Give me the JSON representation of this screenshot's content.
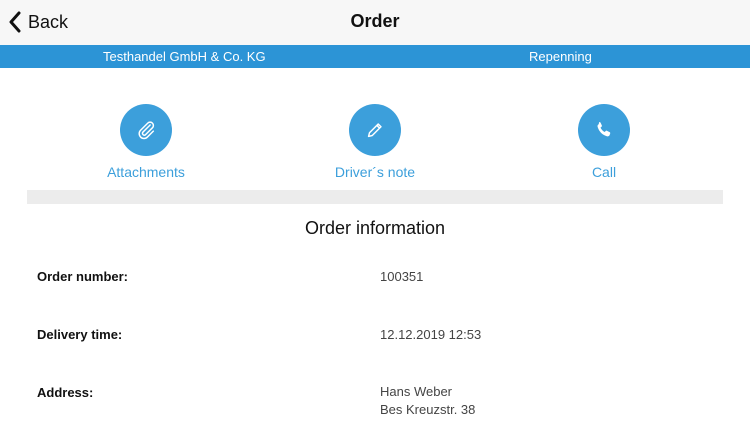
{
  "navbar": {
    "back_label": "Back",
    "title": "Order"
  },
  "infobar": {
    "company": "Testhandel GmbH & Co. KG",
    "person": "Repenning"
  },
  "actions": [
    {
      "label": "Attachments",
      "icon": "paperclip-icon"
    },
    {
      "label": "Driver´s note",
      "icon": "pencil-icon"
    },
    {
      "label": "Call",
      "icon": "phone-icon"
    }
  ],
  "colors": {
    "accent": "#2c94d6",
    "button": "#3c9fdb"
  },
  "order_info": {
    "title": "Order information",
    "rows": [
      {
        "label": "Order number:",
        "value": "100351"
      },
      {
        "label": "Delivery time:",
        "value": "12.12.2019 12:53"
      },
      {
        "label": "Address:",
        "value_lines": [
          "Hans Weber",
          "Bes Kreuzstr. 38"
        ]
      }
    ]
  }
}
